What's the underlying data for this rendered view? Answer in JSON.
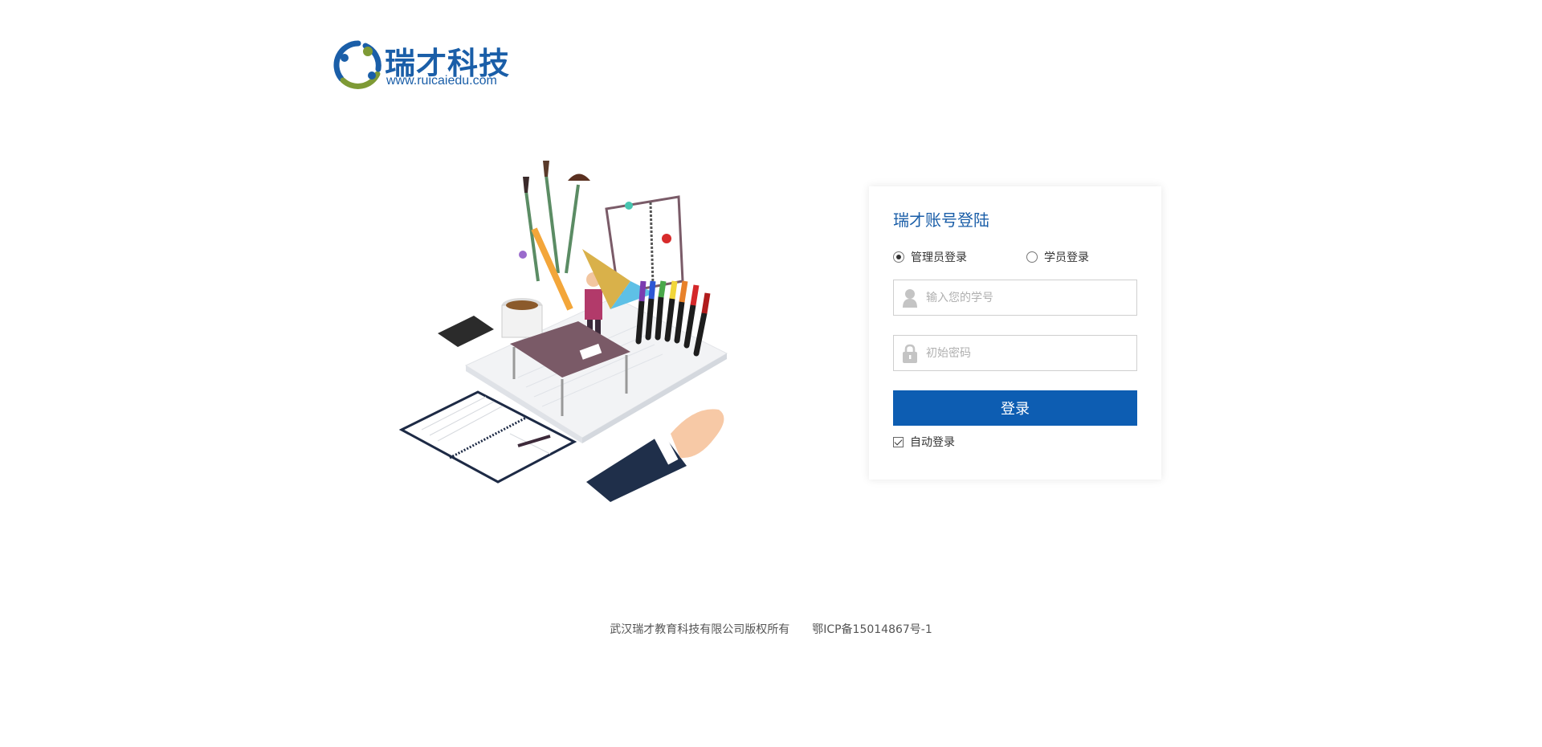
{
  "brand": {
    "name": "瑞才科技",
    "url": "www.ruicaiedu.com",
    "colors": {
      "primary": "#1a5ea8",
      "accent_green": "#7e9a35"
    }
  },
  "login": {
    "title": "瑞才账号登陆",
    "roles": [
      {
        "label": "管理员登录",
        "checked": true
      },
      {
        "label": "学员登录",
        "checked": false
      }
    ],
    "username": {
      "placeholder": "输入您的学号",
      "value": "",
      "icon": "user-icon"
    },
    "password": {
      "placeholder": "初始密码",
      "value": "",
      "icon": "lock-icon"
    },
    "submit_label": "登录",
    "auto_login": {
      "label": "自动登录",
      "checked": true
    },
    "button_color": "#0d5db2"
  },
  "footer": {
    "copyright": "武汉瑞才教育科技有限公司版权所有",
    "icp": "鄂ICP备15014867号-1"
  }
}
